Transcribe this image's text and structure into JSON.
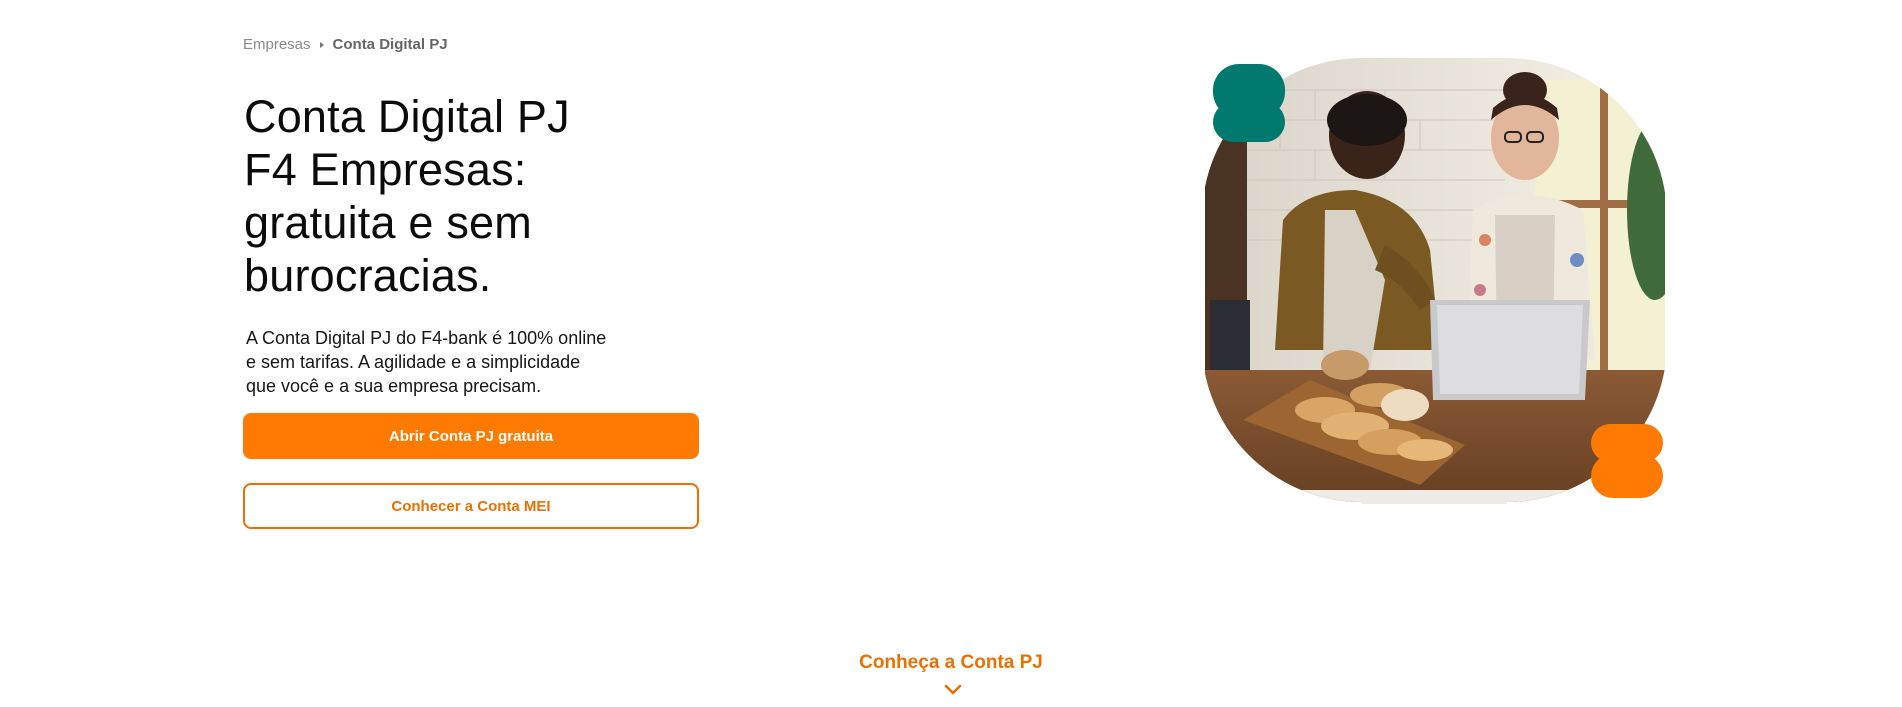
{
  "breadcrumb": {
    "parent": "Empresas",
    "current": "Conta Digital PJ"
  },
  "hero": {
    "title_lines": [
      "Conta Digital PJ",
      "F4 Empresas:",
      "gratuita e sem",
      "burocracias."
    ],
    "description_lines": [
      "A Conta Digital PJ do F4-bank é 100% online",
      "e sem tarifas. A agilidade e a simplicidade",
      "que você e a sua empresa precisam."
    ],
    "primary_button": "Abrir Conta PJ gratuita",
    "secondary_button": "Conhecer a Conta MEI",
    "image_icon": "people-with-laptop-photo"
  },
  "scroll": {
    "label": "Conheça a Conta PJ",
    "icon": "chevron-down-icon"
  },
  "colors": {
    "brand_orange": "#ff7a00",
    "outline_orange": "#ec7000",
    "accent_teal": "#007a6e"
  }
}
